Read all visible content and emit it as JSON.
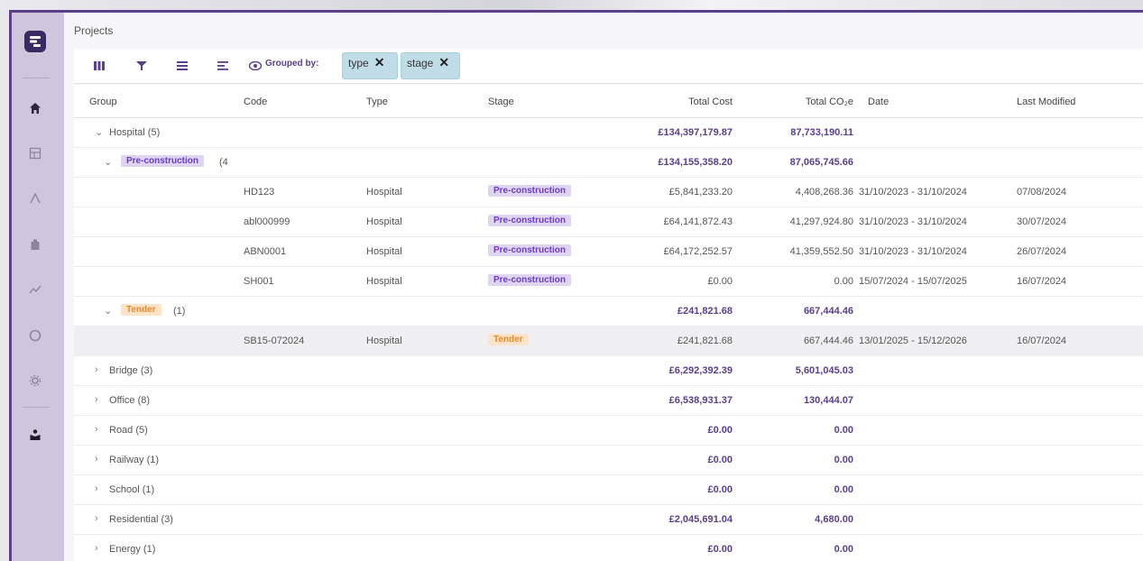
{
  "page_title": "Projects",
  "toolbar": {
    "grouped_by_label": "Grouped by:",
    "chips": [
      "type",
      "stage"
    ],
    "icons": [
      "columns-icon",
      "filter-icon",
      "density-icon",
      "sort-icon",
      "visibility-icon"
    ]
  },
  "columns": {
    "group": "Group",
    "code": "Code",
    "type": "Type",
    "stage": "Stage",
    "total_cost": "Total Cost",
    "total_co2": "Total CO₂e",
    "date": "Date",
    "last_modified": "Last Modified"
  },
  "rows": {
    "hospital": {
      "label": "Hospital (5)",
      "cost": "£134,397,179.87",
      "co2": "87,733,190.11"
    },
    "preconstruction": {
      "badge": "Pre-construction",
      "count": "(4",
      "cost": "£134,155,358.20",
      "co2": "87,065,745.66"
    },
    "items": [
      {
        "code": "HD123",
        "type": "Hospital",
        "stage": "Pre-construction",
        "cost": "£5,841,233.20",
        "co2": "4,408,268.36",
        "date": "31/10/2023 - 31/10/2024",
        "modified": "07/08/2024"
      },
      {
        "code": "abl000999",
        "type": "Hospital",
        "stage": "Pre-construction",
        "cost": "£64,141,872.43",
        "co2": "41,297,924.80",
        "date": "31/10/2023 - 31/10/2024",
        "modified": "30/07/2024"
      },
      {
        "code": "ABN0001",
        "type": "Hospital",
        "stage": "Pre-construction",
        "cost": "£64,172,252.57",
        "co2": "41,359,552.50",
        "date": "31/10/2023 - 31/10/2024",
        "modified": "26/07/2024"
      },
      {
        "code": "SH001",
        "type": "Hospital",
        "stage": "Pre-construction",
        "cost": "£0.00",
        "co2": "0.00",
        "date": "15/07/2024 - 15/07/2025",
        "modified": "16/07/2024"
      }
    ],
    "tender": {
      "badge": "Tender",
      "count": "(1)",
      "cost": "£241,821.68",
      "co2": "667,444.46"
    },
    "tender_item": {
      "code": "SB15-072024",
      "type": "Hospital",
      "stage": "Tender",
      "cost": "£241,821.68",
      "co2": "667,444.46",
      "date": "13/01/2025 - 15/12/2026",
      "modified": "16/07/2024"
    },
    "groups": [
      {
        "label": "Bridge (3)",
        "cost": "£6,292,392.39",
        "co2": "5,601,045.03"
      },
      {
        "label": "Office (8)",
        "cost": "£6,538,931.37",
        "co2": "130,444.07"
      },
      {
        "label": "Road (5)",
        "cost": "£0.00",
        "co2": "0.00"
      },
      {
        "label": "Railway (1)",
        "cost": "£0.00",
        "co2": "0.00"
      },
      {
        "label": "School (1)",
        "cost": "£0.00",
        "co2": "0.00"
      },
      {
        "label": "Residential (3)",
        "cost": "£2,045,691.04",
        "co2": "4,680.00"
      },
      {
        "label": "Energy (1)",
        "cost": "£0.00",
        "co2": "0.00"
      }
    ]
  },
  "colors": {
    "accent": "#5b3f8a",
    "sidebar": "#cfc6dd",
    "chip": "#bfdce7",
    "preconstruction_badge": "#e0d4f3",
    "tender_badge": "#fde3c8"
  }
}
